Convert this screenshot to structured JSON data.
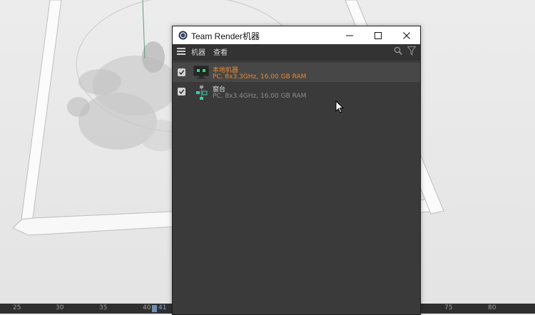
{
  "window": {
    "title": "Team Render机器",
    "menu": [
      "机器",
      "查看"
    ]
  },
  "machines": [
    {
      "name": "本地机器",
      "spec": "PC, 8x3.3GHz, 16.00 GB RAM",
      "checked": true,
      "selected": true
    },
    {
      "name": "窗台",
      "spec": "PC, 8x3.4GHz, 16.00 GB RAM",
      "checked": true,
      "selected": false
    }
  ],
  "timeline": {
    "ticks_left": [
      "25",
      "30",
      "35",
      "40",
      "41"
    ],
    "ticks_right": [
      "75",
      "80"
    ]
  },
  "colors": {
    "accent": "#e88a2e",
    "window_bg": "#3a3a3a",
    "viewport_bg": "#e8e8e8"
  }
}
